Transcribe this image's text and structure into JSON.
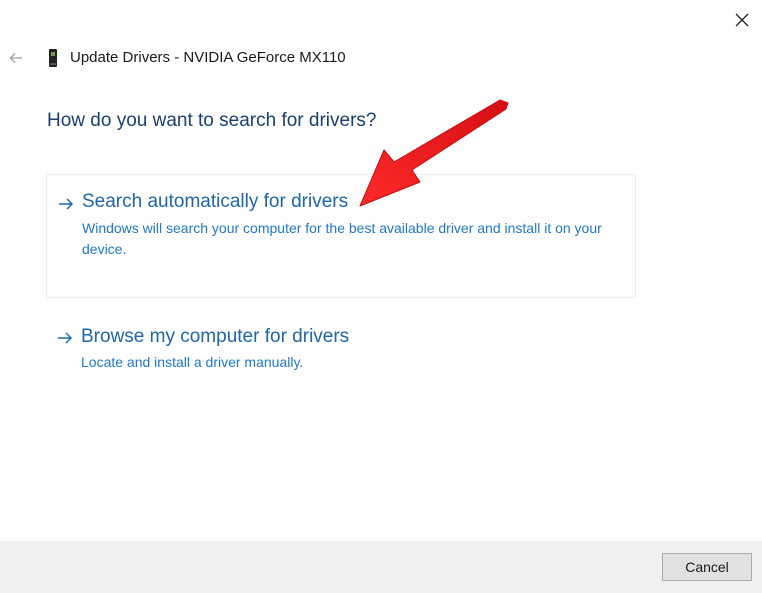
{
  "window": {
    "title": "Update Drivers - NVIDIA GeForce MX110",
    "back_icon": "back-arrow-icon",
    "close_icon": "close-icon",
    "title_icon": "graphics-card-icon"
  },
  "main": {
    "heading": "How do you want to search for drivers?",
    "options": [
      {
        "title": "Search automatically for drivers",
        "description": "Windows will search your computer for the best available driver and install it on your device.",
        "icon": "right-arrow-icon"
      },
      {
        "title": "Browse my computer for drivers",
        "description": "Locate and install a driver manually.",
        "icon": "right-arrow-icon"
      }
    ]
  },
  "annotation": {
    "icon": "red-pointer-arrow-icon",
    "color": "#e8161b"
  },
  "footer": {
    "cancel_label": "Cancel"
  },
  "colors": {
    "heading": "#1c3f73",
    "link": "#1f66a8",
    "description": "#1f78c8",
    "footer_bg": "#f0f0f0"
  }
}
